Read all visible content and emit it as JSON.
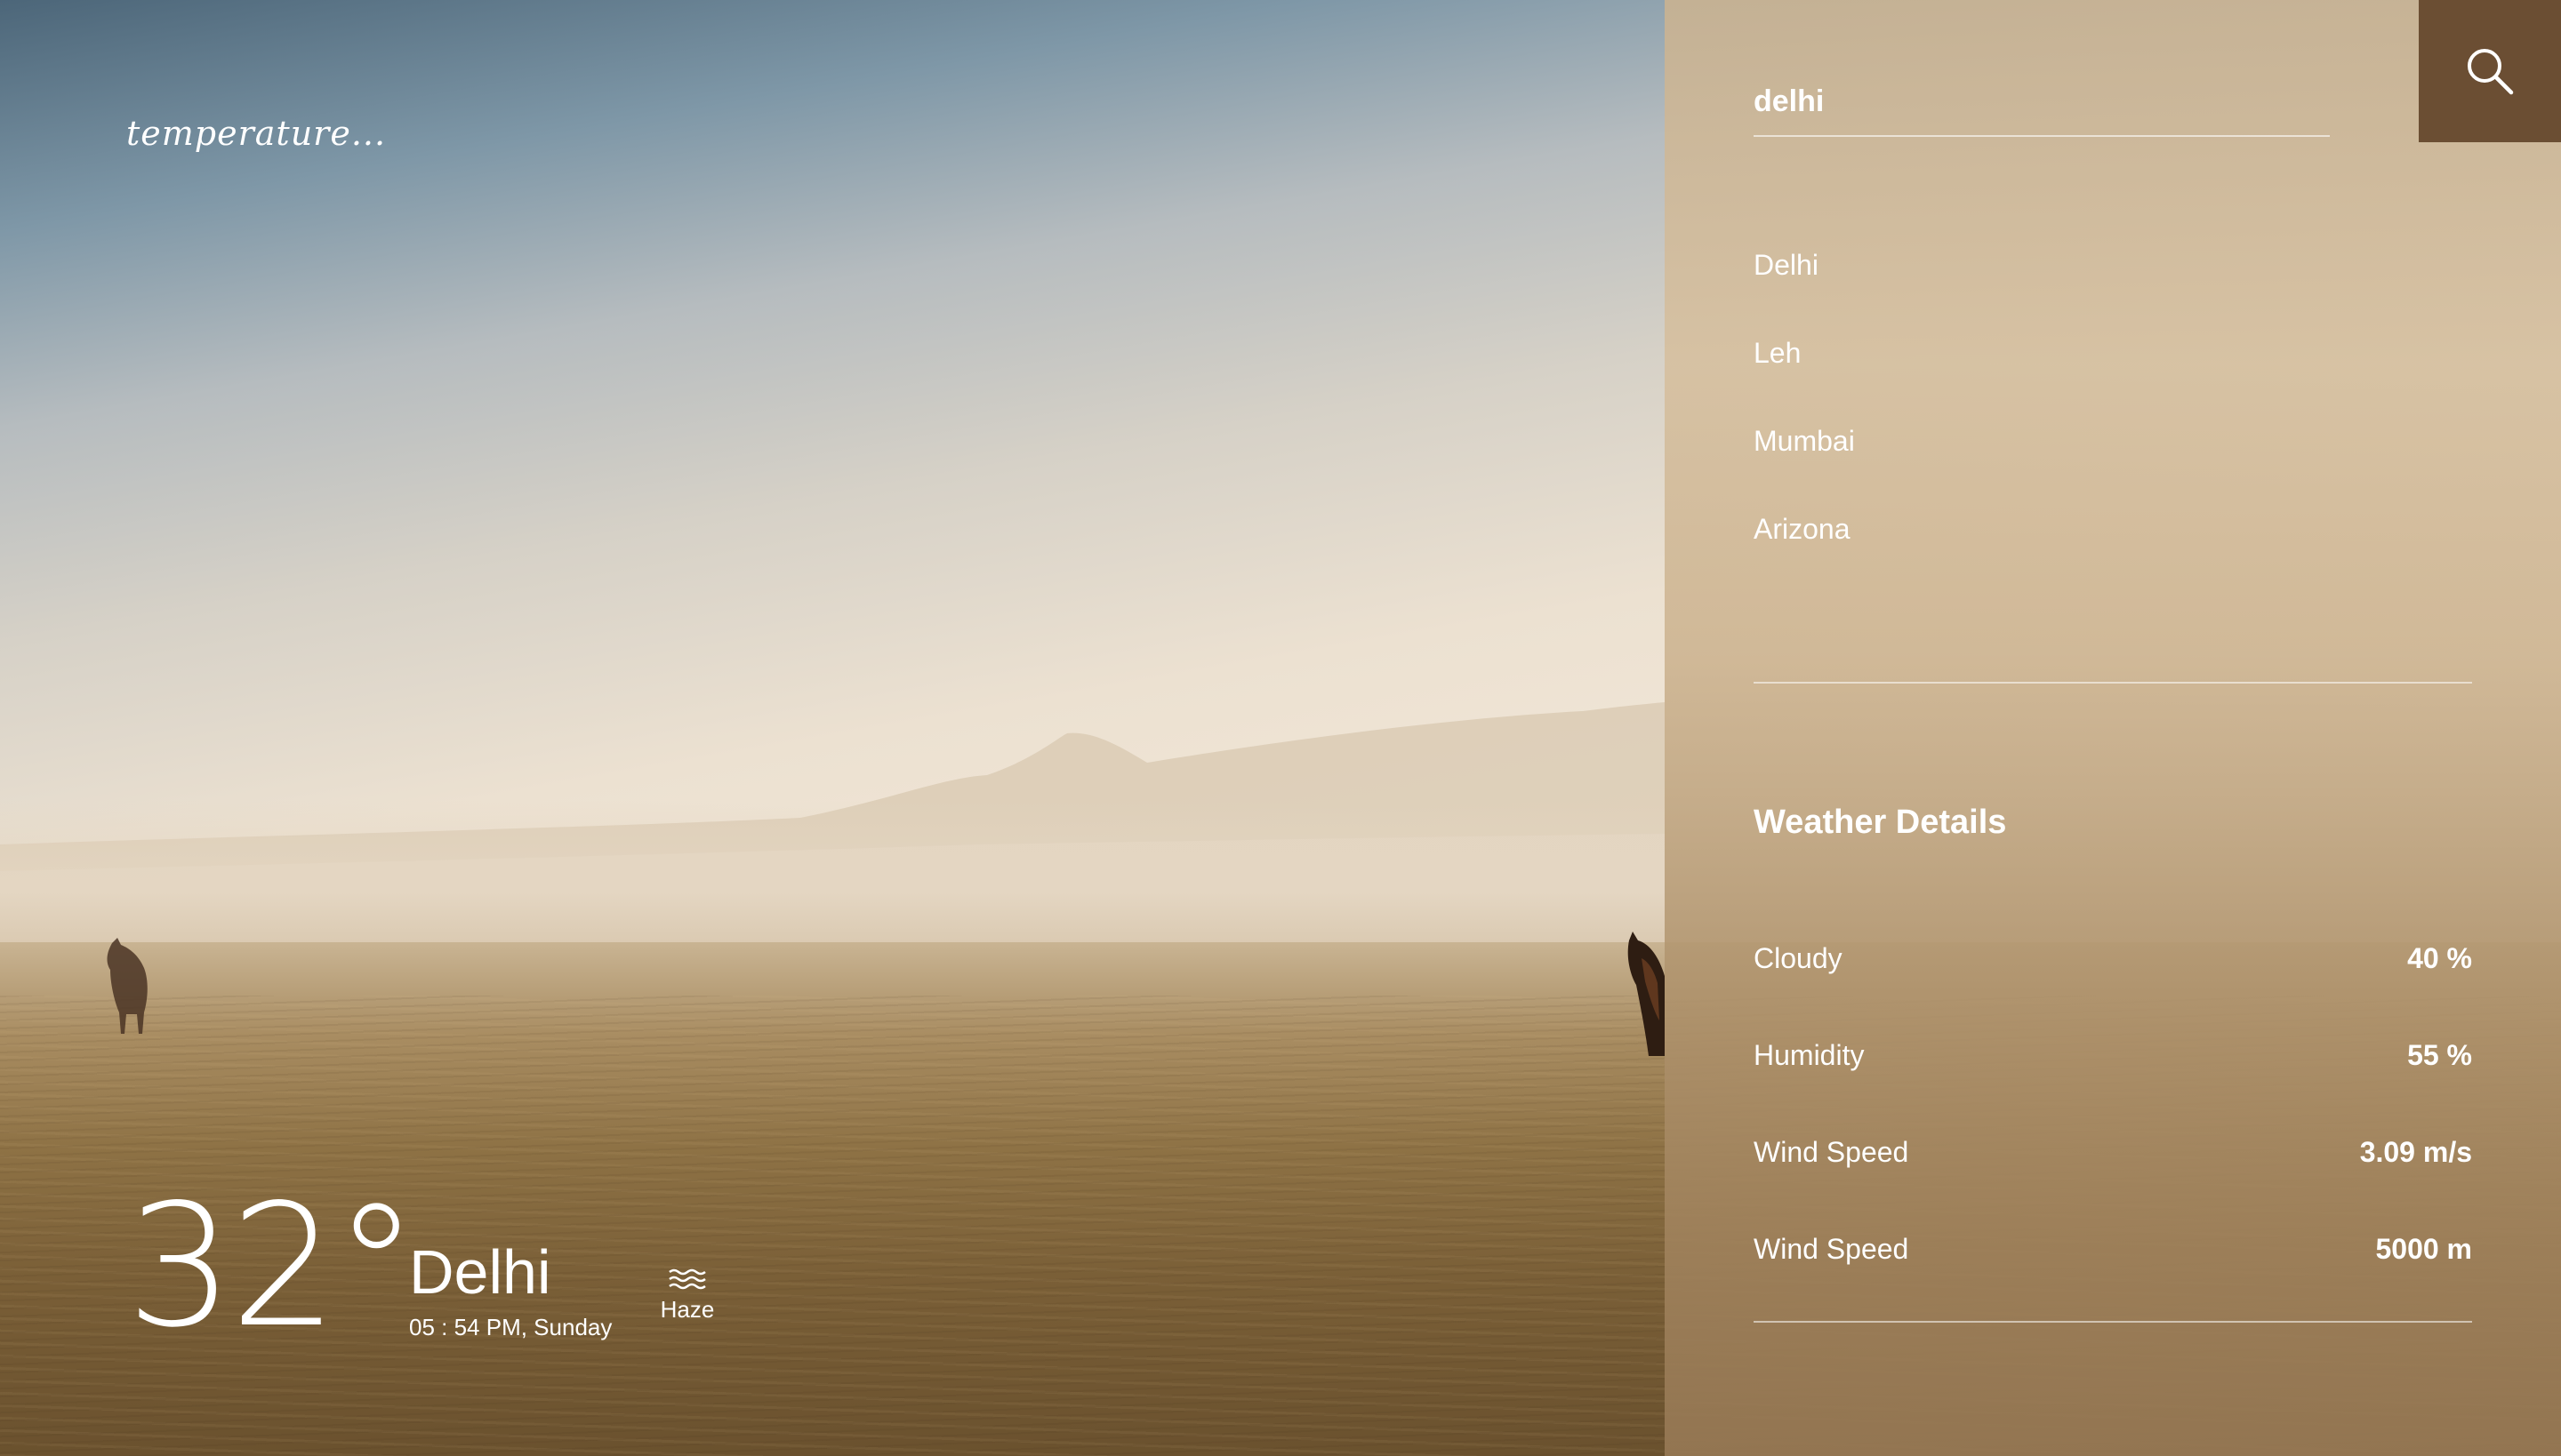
{
  "brand": {
    "text": "temperature..."
  },
  "current": {
    "temperature": "32°",
    "city": "Delhi",
    "datetime": "05 : 54 PM, Sunday",
    "condition": "Haze",
    "condition_icon": "haze-icon"
  },
  "search": {
    "value": "delhi",
    "icon": "search-icon"
  },
  "cities": [
    {
      "label": "Delhi"
    },
    {
      "label": "Leh"
    },
    {
      "label": "Mumbai"
    },
    {
      "label": "Arizona"
    }
  ],
  "details": {
    "title": "Weather Details",
    "rows": [
      {
        "label": "Cloudy",
        "value": "40 %"
      },
      {
        "label": "Humidity",
        "value": "55 %"
      },
      {
        "label": "Wind Speed",
        "value": "3.09 m/s"
      },
      {
        "label": "Wind Speed",
        "value": "5000 m"
      }
    ]
  },
  "colors": {
    "search_button": "#6b4e33",
    "text": "#ffffff"
  }
}
